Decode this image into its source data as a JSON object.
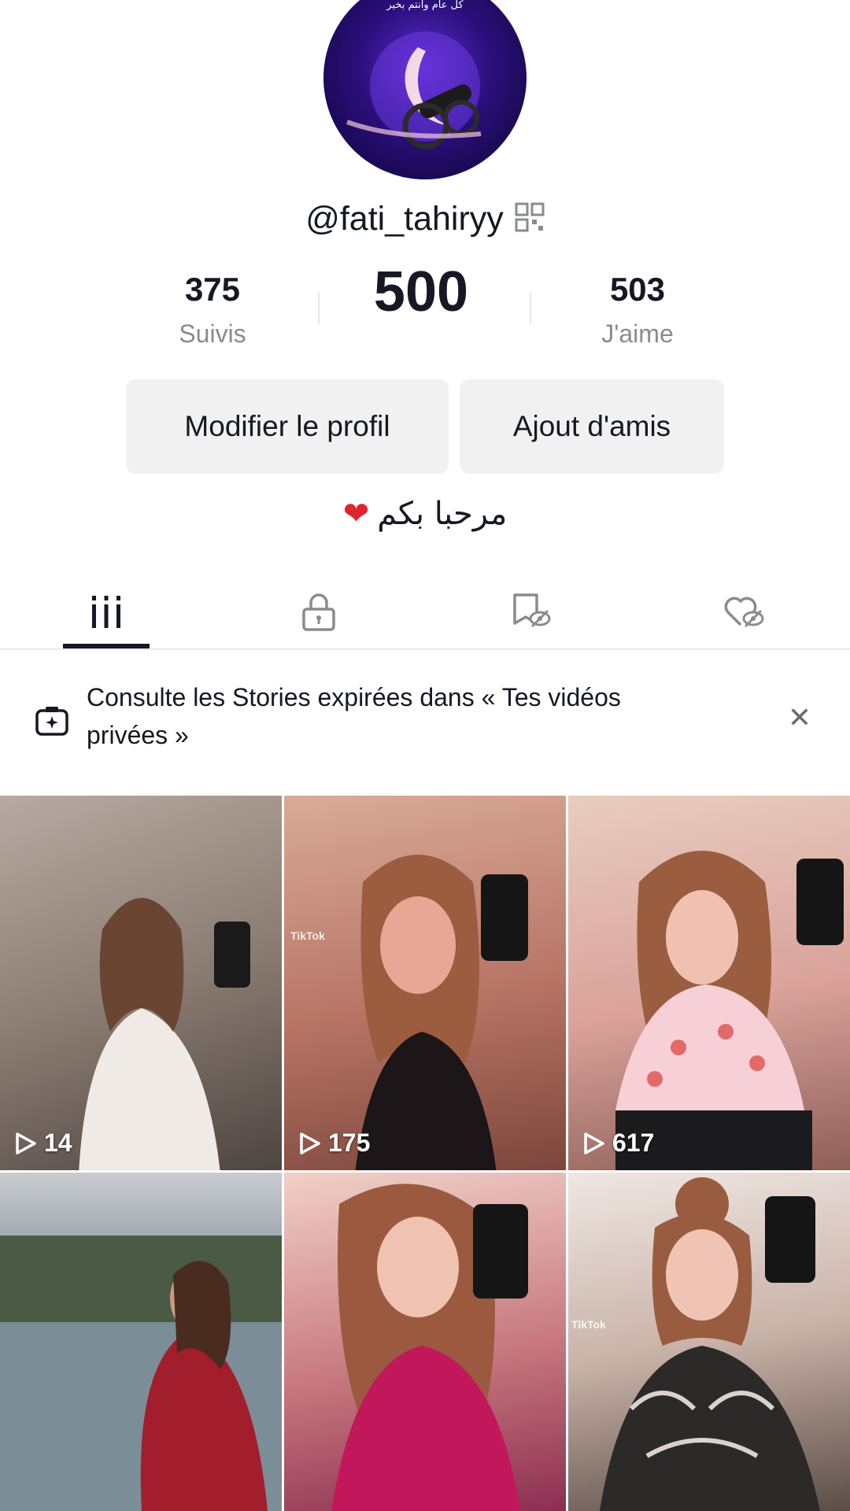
{
  "profile": {
    "avatar_badge_line": "كل عام وانتم بخير",
    "username": "@fati_tahiryy",
    "bio_text": "مرحبا بكم"
  },
  "stats": {
    "following_count": "375",
    "following_label": "Suivis",
    "followers_count": "500",
    "likes_count": "503",
    "likes_label": "J'aime"
  },
  "buttons": {
    "edit_profile": "Modifier le profil",
    "add_friends": "Ajout d'amis"
  },
  "tabs": [
    {
      "icon": "grid-icon",
      "active": true
    },
    {
      "icon": "lock-icon",
      "active": false
    },
    {
      "icon": "hidden-bookmark-icon",
      "active": false
    },
    {
      "icon": "hidden-heart-icon",
      "active": false
    }
  ],
  "banner": {
    "icon": "story-camera-icon",
    "text": "Consulte les Stories expirées dans « Tes vidéos privées »",
    "close_icon": "close-icon"
  },
  "videos": [
    {
      "views": "14",
      "color": "#8d7e74"
    },
    {
      "views": "175",
      "color": "#b77465"
    },
    {
      "views": "617",
      "color": "#d9a19a"
    },
    {
      "views": "",
      "color": "#6b7d86"
    },
    {
      "views": "",
      "color": "#c7797f"
    },
    {
      "views": "",
      "color": "#8f7a70"
    }
  ],
  "watermarks": {
    "tiktok": "TikTok"
  },
  "colors": {
    "text": "#161823",
    "secondary": "#8a8b91",
    "button_bg": "#f1f1f2",
    "heart": "#e0242f"
  }
}
